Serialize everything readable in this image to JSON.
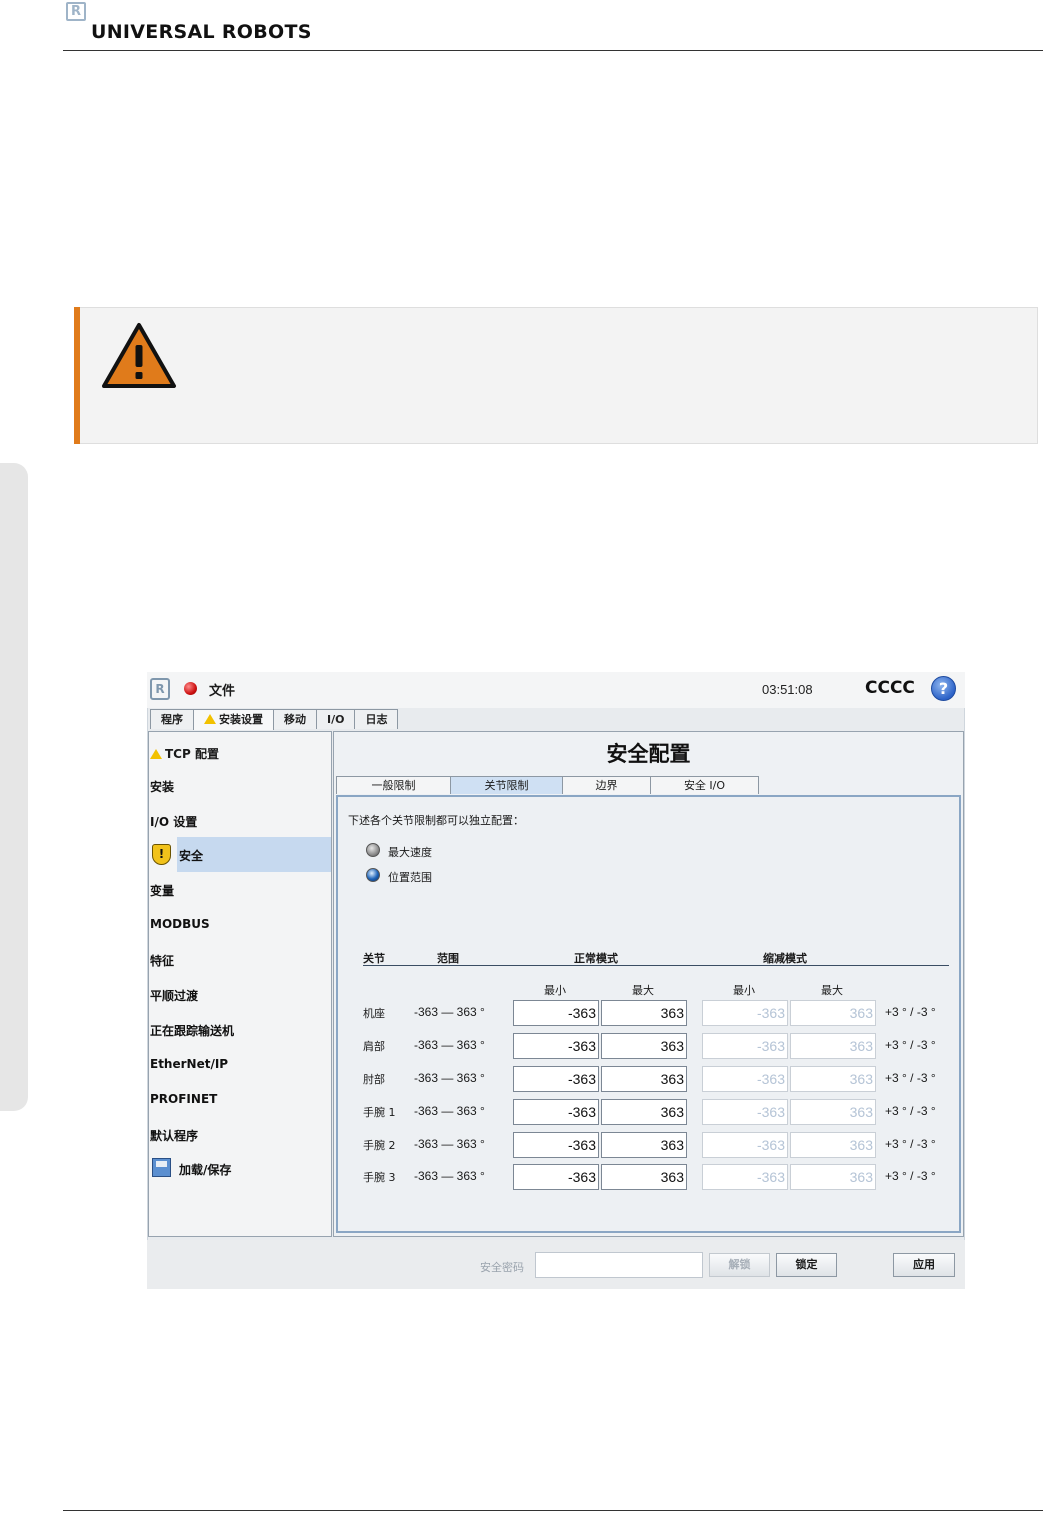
{
  "doc": {
    "brand": "UNIVERSAL ROBOTS"
  },
  "app": {
    "menu_file": "文件",
    "clock": "03:51:08",
    "robot_name": "CCCC",
    "help": "?",
    "top_tabs": [
      "程序",
      "安装设置",
      "移动",
      "I/O",
      "日志"
    ],
    "sidebar": [
      "TCP 配置",
      "安装",
      "I/O 设置",
      "安全",
      "变量",
      "MODBUS",
      "特征",
      "平顺过渡",
      "正在跟踪输送机",
      "EtherNet/IP",
      "PROFINET",
      "默认程序",
      "加载/保存"
    ],
    "page_title": "安全配置",
    "sub_tabs": [
      "一般限制",
      "关节限制",
      "边界",
      "安全 I/O"
    ],
    "description": "下述各个关节限制都可以独立配置：",
    "radios": [
      {
        "label": "最大速度",
        "selected": false
      },
      {
        "label": "位置范围",
        "selected": true
      }
    ],
    "table": {
      "headers": {
        "joint": "关节",
        "range": "范围",
        "normal": "正常模式",
        "reduced": "缩减模式"
      },
      "sub_headers": {
        "normal_min": "最小",
        "normal_max": "最大",
        "reduced_min": "最小",
        "reduced_max": "最大"
      },
      "rows": [
        {
          "joint": "机座",
          "range": "-363 — 363 °",
          "normal_min": "-363",
          "normal_max": "363",
          "reduced_min": "-363",
          "reduced_max": "363",
          "tolerance": "+3 ° / -3 °"
        },
        {
          "joint": "肩部",
          "range": "-363 — 363 °",
          "normal_min": "-363",
          "normal_max": "363",
          "reduced_min": "-363",
          "reduced_max": "363",
          "tolerance": "+3 ° / -3 °"
        },
        {
          "joint": "肘部",
          "range": "-363 — 363 °",
          "normal_min": "-363",
          "normal_max": "363",
          "reduced_min": "-363",
          "reduced_max": "363",
          "tolerance": "+3 ° / -3 °"
        },
        {
          "joint": "手腕 1",
          "range": "-363 — 363 °",
          "normal_min": "-363",
          "normal_max": "363",
          "reduced_min": "-363",
          "reduced_max": "363",
          "tolerance": "+3 ° / -3 °"
        },
        {
          "joint": "手腕 2",
          "range": "-363 — 363 °",
          "normal_min": "-363",
          "normal_max": "363",
          "reduced_min": "-363",
          "reduced_max": "363",
          "tolerance": "+3 ° / -3 °"
        },
        {
          "joint": "手腕 3",
          "range": "-363 — 363 °",
          "normal_min": "-363",
          "normal_max": "363",
          "reduced_min": "-363",
          "reduced_max": "363",
          "tolerance": "+3 ° / -3 °"
        }
      ]
    },
    "bottom": {
      "password_label": "安全密码",
      "password_value": "",
      "unlock": "解锁",
      "lock": "锁定",
      "apply": "应用"
    }
  },
  "colors": {
    "warning_accent": "#e07b1b",
    "selection": "#c6d9ef",
    "tab_active": "#cfe0f3"
  }
}
